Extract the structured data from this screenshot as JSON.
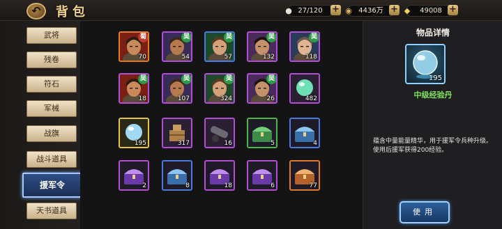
{
  "header": {
    "back_icon": "back-arrow-icon",
    "title": "背包",
    "resources": [
      {
        "icon": "bag-capacity-icon",
        "value": "27/120"
      },
      {
        "icon": "copper-coin-icon",
        "value": "4436万"
      },
      {
        "icon": "gold-ingot-icon",
        "value": "49008"
      }
    ],
    "plus_label": "+"
  },
  "sidebar": {
    "tabs": [
      {
        "label": "武将",
        "active": false
      },
      {
        "label": "残卷",
        "active": false
      },
      {
        "label": "符石",
        "active": false
      },
      {
        "label": "军械",
        "active": false
      },
      {
        "label": "战旗",
        "active": false
      },
      {
        "label": "战斗道具",
        "active": false
      },
      {
        "label": "援军令",
        "active": true
      },
      {
        "label": "天书道具",
        "active": false
      }
    ]
  },
  "items": [
    {
      "kind": "general-portrait",
      "quality": "orange",
      "count": "70",
      "badge": "蜀"
    },
    {
      "kind": "general-portrait",
      "quality": "purple",
      "count": "54",
      "badge": "吴"
    },
    {
      "kind": "general-portrait",
      "quality": "blue",
      "count": "57",
      "badge": "吴"
    },
    {
      "kind": "general-portrait",
      "quality": "purple",
      "count": "132",
      "badge": "吴"
    },
    {
      "kind": "general-portrait",
      "quality": "purple",
      "count": "118",
      "badge": "吴"
    },
    {
      "kind": "general-portrait",
      "quality": "purple",
      "count": "18",
      "badge": "吴"
    },
    {
      "kind": "general-portrait",
      "quality": "purple",
      "count": "107",
      "badge": "吴"
    },
    {
      "kind": "general-portrait",
      "quality": "purple",
      "count": "324",
      "badge": "吴"
    },
    {
      "kind": "general-portrait",
      "quality": "purple",
      "count": "26",
      "badge": "吴"
    },
    {
      "kind": "green-orb",
      "quality": "purple",
      "count": "482",
      "badge": ""
    },
    {
      "kind": "blue-orb",
      "quality": "gold",
      "count": "195",
      "badge": ""
    },
    {
      "kind": "bronze-box",
      "quality": "purple",
      "count": "317",
      "badge": ""
    },
    {
      "kind": "cannon",
      "quality": "purple",
      "count": "16",
      "badge": ""
    },
    {
      "kind": "green-chest",
      "quality": "green",
      "count": "5",
      "badge": ""
    },
    {
      "kind": "blue-chest",
      "quality": "blue",
      "count": "4",
      "badge": ""
    },
    {
      "kind": "purple-chest",
      "quality": "purple",
      "count": "2",
      "badge": ""
    },
    {
      "kind": "blue-chest",
      "quality": "blue",
      "count": "8",
      "badge": ""
    },
    {
      "kind": "purple-chest",
      "quality": "purple",
      "count": "18",
      "badge": ""
    },
    {
      "kind": "purple-chest",
      "quality": "purple",
      "count": "6",
      "badge": ""
    },
    {
      "kind": "orange-chest",
      "quality": "orange",
      "count": "77",
      "badge": ""
    }
  ],
  "detail": {
    "title": "物品详情",
    "icon": "blue-orb-icon",
    "count": "195",
    "name": "中级经验丹",
    "description": "蕴含中量能量精华，用于援军令兵种升级。使用后援军获得200经验。",
    "use_label": "使用"
  },
  "colors": {
    "accent_blue": "#2d5f9b",
    "title_gold": "#f1d48a",
    "item_name_green": "#7fe05b"
  }
}
